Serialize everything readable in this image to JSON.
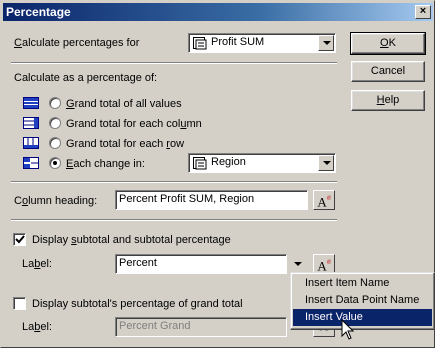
{
  "window": {
    "title": "Percentage",
    "close_glyph": "×"
  },
  "calc_for": {
    "label_pre": "",
    "label_u": "C",
    "label_post": "alculate percentages for",
    "value": "Profit SUM"
  },
  "calc_as": {
    "label": "Calculate as a percentage of:"
  },
  "options": [
    {
      "pre": "",
      "u": "G",
      "post": "rand total of all values",
      "selected": false
    },
    {
      "pre": "Grand total for each col",
      "u": "u",
      "post": "mn",
      "selected": false
    },
    {
      "pre": "Grand total for each ",
      "u": "r",
      "post": "ow",
      "selected": false
    },
    {
      "pre": "",
      "u": "E",
      "post": "ach change in:",
      "selected": true
    }
  ],
  "each_change": {
    "value": "Region"
  },
  "column_heading": {
    "label_pre": "C",
    "label_u": "o",
    "label_post": "lumn heading:",
    "value": "Percent Profit SUM, Region"
  },
  "subtotal": {
    "checked": true,
    "label_pre": "Display ",
    "label_u": "s",
    "label_post": "ubtotal and subtotal percentage",
    "field_label_pre": "La",
    "field_label_u": "b",
    "field_label_post": "el:",
    "value": "Percent"
  },
  "grand_pct": {
    "checked": false,
    "label": "Display subtotal's percentage of grand total",
    "field_label_pre": "La",
    "field_label_u": "b",
    "field_label_post": "el:",
    "value": "Percent Grand"
  },
  "buttons": {
    "ok_u": "O",
    "ok_post": "K",
    "cancel": "Cancel",
    "help_u": "H",
    "help_post": "elp"
  },
  "insert_button": {
    "glyph": "A",
    "sup": "ᵈˡ"
  },
  "menu": {
    "items": [
      "Insert Item Name",
      "Insert Data Point Name",
      "Insert Value"
    ],
    "highlighted_index": 2
  },
  "colors": {
    "title_start": "#0a246a",
    "highlight": "#0a246a",
    "face": "#d4d0c8"
  }
}
